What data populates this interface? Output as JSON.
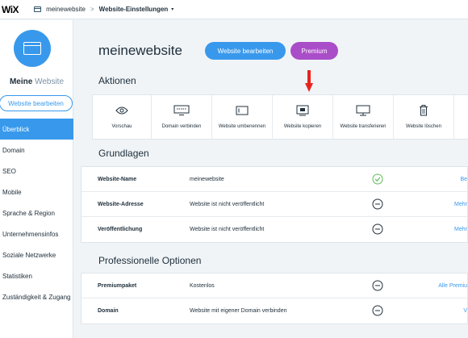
{
  "topbar": {
    "logo": "WiX",
    "site": "meinewebsite",
    "separator": ">",
    "page": "Website-Einstellungen",
    "caret": "▾"
  },
  "sidebar": {
    "title_bold": "Meine",
    "title_light": "Website",
    "edit_button": "Website bearbeiten",
    "items": [
      {
        "label": "Überblick",
        "active": true
      },
      {
        "label": "Domain"
      },
      {
        "label": "SEO"
      },
      {
        "label": "Mobile"
      },
      {
        "label": "Sprache & Region"
      },
      {
        "label": "Unternehmensinfos"
      },
      {
        "label": "Soziale Netzwerke"
      },
      {
        "label": "Statistiken"
      },
      {
        "label": "Zuständigkeit & Zugang"
      }
    ]
  },
  "main": {
    "site_name": "meinewebsite",
    "edit_button": "Website bearbeiten",
    "premium_button": "Premium",
    "actions_title": "Aktionen",
    "actions": [
      {
        "label": "Vorschau",
        "icon": "eye-icon"
      },
      {
        "label": "Domain verbinden",
        "icon": "domain-icon"
      },
      {
        "label": "Website umbenennen",
        "icon": "rename-icon"
      },
      {
        "label": "Website kopieren",
        "icon": "copy-icon"
      },
      {
        "label": "Website transferieren",
        "icon": "transfer-icon"
      },
      {
        "label": "Website löschen",
        "icon": "trash-icon"
      }
    ],
    "basics_title": "Grundlagen",
    "basics": [
      {
        "key": "Website-Name",
        "value": "meinewebsite",
        "status": "check",
        "link": "Be"
      },
      {
        "key": "Website-Adresse",
        "value": "Website ist nicht veröffentlicht",
        "status": "minus",
        "link": "Mehr"
      },
      {
        "key": "Veröffentlichung",
        "value": "Website ist nicht veröffentlicht",
        "status": "minus",
        "link": "Mehr"
      }
    ],
    "pro_title": "Professionelle Optionen",
    "pro": [
      {
        "key": "Premiumpaket",
        "value": "Kostenlos",
        "status": "minus",
        "link": "Alle Premiu"
      },
      {
        "key": "Domain",
        "value": "Website mit eigener Domain verbinden",
        "status": "minus",
        "link": "V"
      }
    ]
  },
  "colors": {
    "accent": "#3899ec",
    "premium": "#aa4dc8",
    "arrow": "#e8231e",
    "ok": "#60bc57",
    "muted": "#7a92a5"
  }
}
